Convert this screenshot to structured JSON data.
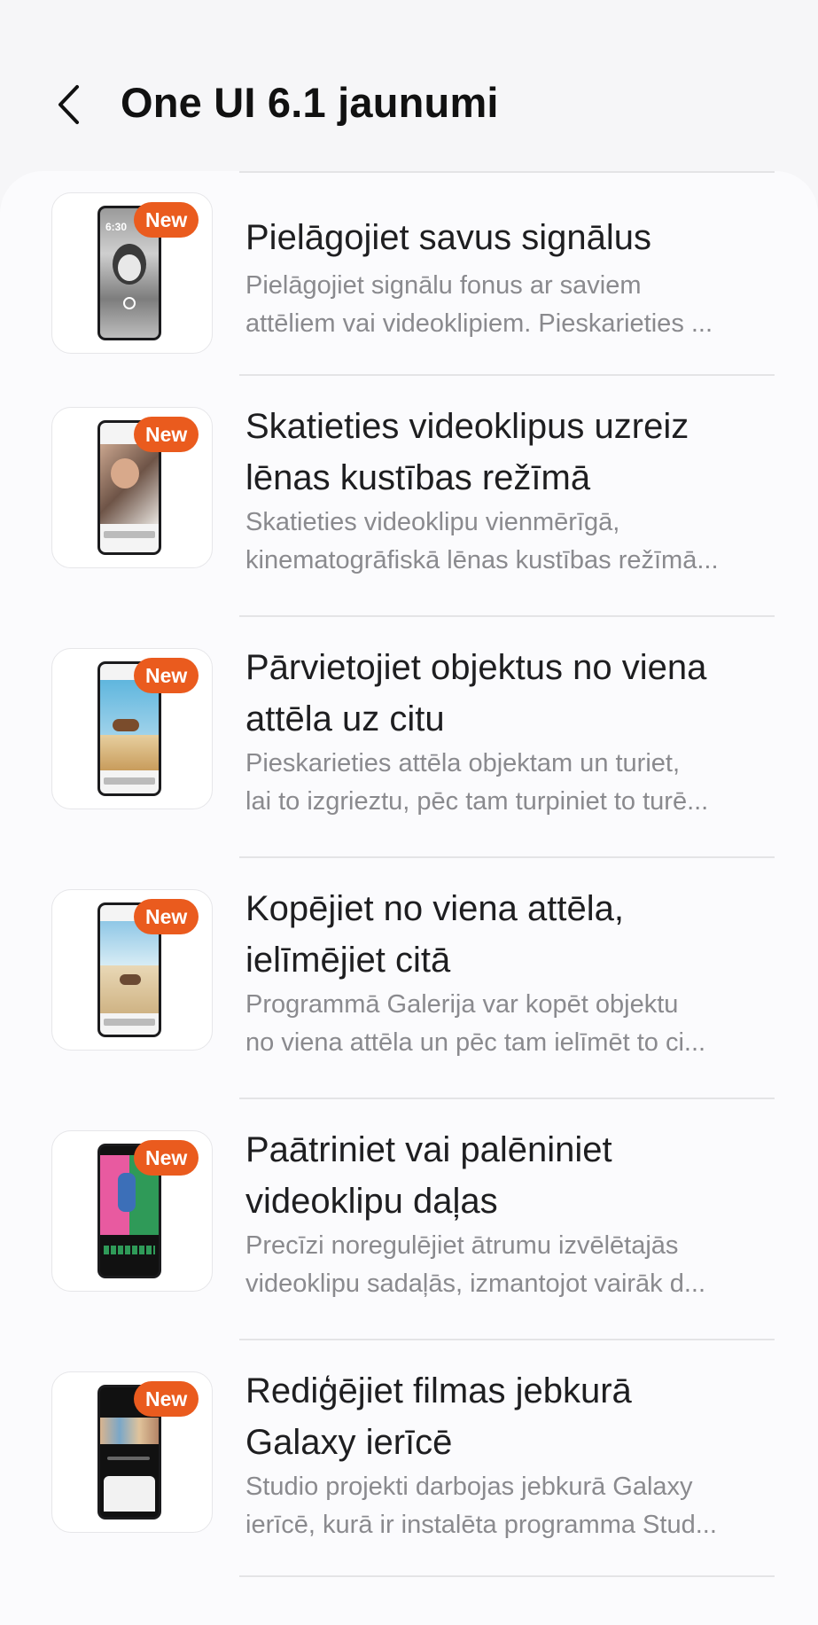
{
  "header": {
    "title": "One UI 6.1 jaunumi",
    "back_icon": "chevron-left-icon"
  },
  "badge_label": "New",
  "items": [
    {
      "title_lines": [
        "Pielāgojiet savus signālus"
      ],
      "desc_lines": [
        "Pielāgojiet signālu fonus ar saviem",
        "attēliem vai videoklipiem. Pieskarieties ..."
      ],
      "thumb_icon": "alarm-penguin-screen-icon",
      "thumb_time": "6:30"
    },
    {
      "title_lines": [
        "Skatieties videoklipus uzreiz",
        "lēnas kustības režīmā"
      ],
      "desc_lines": [
        "Skatieties videoklipu vienmērīgā,",
        "kinematogrāfiskā lēnas kustības režīmā..."
      ],
      "thumb_icon": "slow-motion-video-screen-icon"
    },
    {
      "title_lines": [
        "Pārvietojiet objektus no viena",
        "attēla uz citu"
      ],
      "desc_lines": [
        "Pieskarieties attēla objektam un turiet,",
        "lai to izgrieztu, pēc tam turpiniet to turē..."
      ],
      "thumb_icon": "move-object-screen-icon"
    },
    {
      "title_lines": [
        "Kopējiet no viena attēla,",
        "ielīmējiet citā"
      ],
      "desc_lines": [
        "Programmā Galerija var kopēt objektu",
        "no viena attēla un pēc tam ielīmēt to ci..."
      ],
      "thumb_icon": "copy-paste-screen-icon"
    },
    {
      "title_lines": [
        "Paātriniet vai palēniniet",
        "videoklipu daļas"
      ],
      "desc_lines": [
        "Precīzi noregulējiet ātrumu izvēlētajās",
        "videoklipu sadaļās, izmantojot vairāk d..."
      ],
      "thumb_icon": "video-speed-editor-screen-icon"
    },
    {
      "title_lines": [
        "Rediģējiet filmas jebkurā",
        "Galaxy ierīcē"
      ],
      "desc_lines": [
        "Studio projekti darbojas jebkurā Galaxy",
        "ierīcē, kurā ir instalēta programma Stud..."
      ],
      "thumb_icon": "studio-project-screen-icon"
    }
  ],
  "colors": {
    "badge": "#ea5b1e",
    "background": "#f6f6f8",
    "card": "#fbfbfd",
    "title": "#1e1e20",
    "description": "#8a8a8e"
  }
}
